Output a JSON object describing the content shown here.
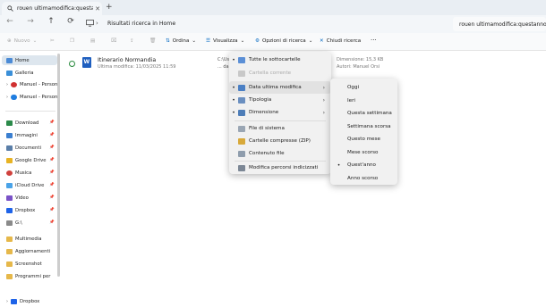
{
  "tab": {
    "title": "rouen ultimamodifica:questan",
    "new_tab": "+"
  },
  "address": {
    "breadcrumb": "Risultati ricerca in Home",
    "search_value": "rouen ultimamodifica:questanno"
  },
  "toolbar": {
    "new": "Nuovo",
    "sort": "Ordina",
    "view": "Visualizza",
    "search_options": "Opzioni di ricerca",
    "close_search": "Chiudi ricerca",
    "more": "···"
  },
  "sidebar": {
    "home": "Home",
    "gallery": "Galleria",
    "accounts": [
      "Manuel - Person",
      "Manuel - Person"
    ],
    "pinned": [
      "Download",
      "Immagini",
      "Documenti",
      "Google Drive",
      "Musica",
      "iCloud Drive",
      "Video",
      "Dropbox",
      "G:\\"
    ],
    "folders": [
      "Multimedia",
      "Aggiornamenti",
      "Screenshot",
      "Programmi per"
    ],
    "bottom": "Dropbox"
  },
  "result": {
    "name": "Itinerario Normandia",
    "meta": "Ultima modifica: 11/03/2025 11:59",
    "path_line1": "C:\\Us",
    "path_line2": "... da",
    "size": "Dimensione: 15,3 KB",
    "author": "Autori: Manuel Orsi"
  },
  "menu": {
    "items": [
      {
        "label": "Tutte le sottocartelle",
        "checked": true
      },
      {
        "label": "Cartella corrente",
        "disabled": true
      },
      {
        "label": "Data ultima modifica"
      },
      {
        "label": "Tipologia"
      },
      {
        "label": "Dimensione"
      },
      {
        "label": "File di sistema"
      },
      {
        "label": "Cartelle compresse (ZIP)"
      },
      {
        "label": "Contenuto file"
      },
      {
        "label": "Modifica percorsi indicizzati"
      }
    ]
  },
  "submenu": {
    "items": [
      "Oggi",
      "Ieri",
      "Questa settimana",
      "Settimana scorsa",
      "Questo mese",
      "Mese scorso",
      "Quest'anno",
      "Anno scorso"
    ],
    "selected": "Quest'anno"
  },
  "colors": {
    "accent": "#0067c0",
    "menu_bg": "#f1f1f1",
    "home_active": "#dde6ee"
  }
}
